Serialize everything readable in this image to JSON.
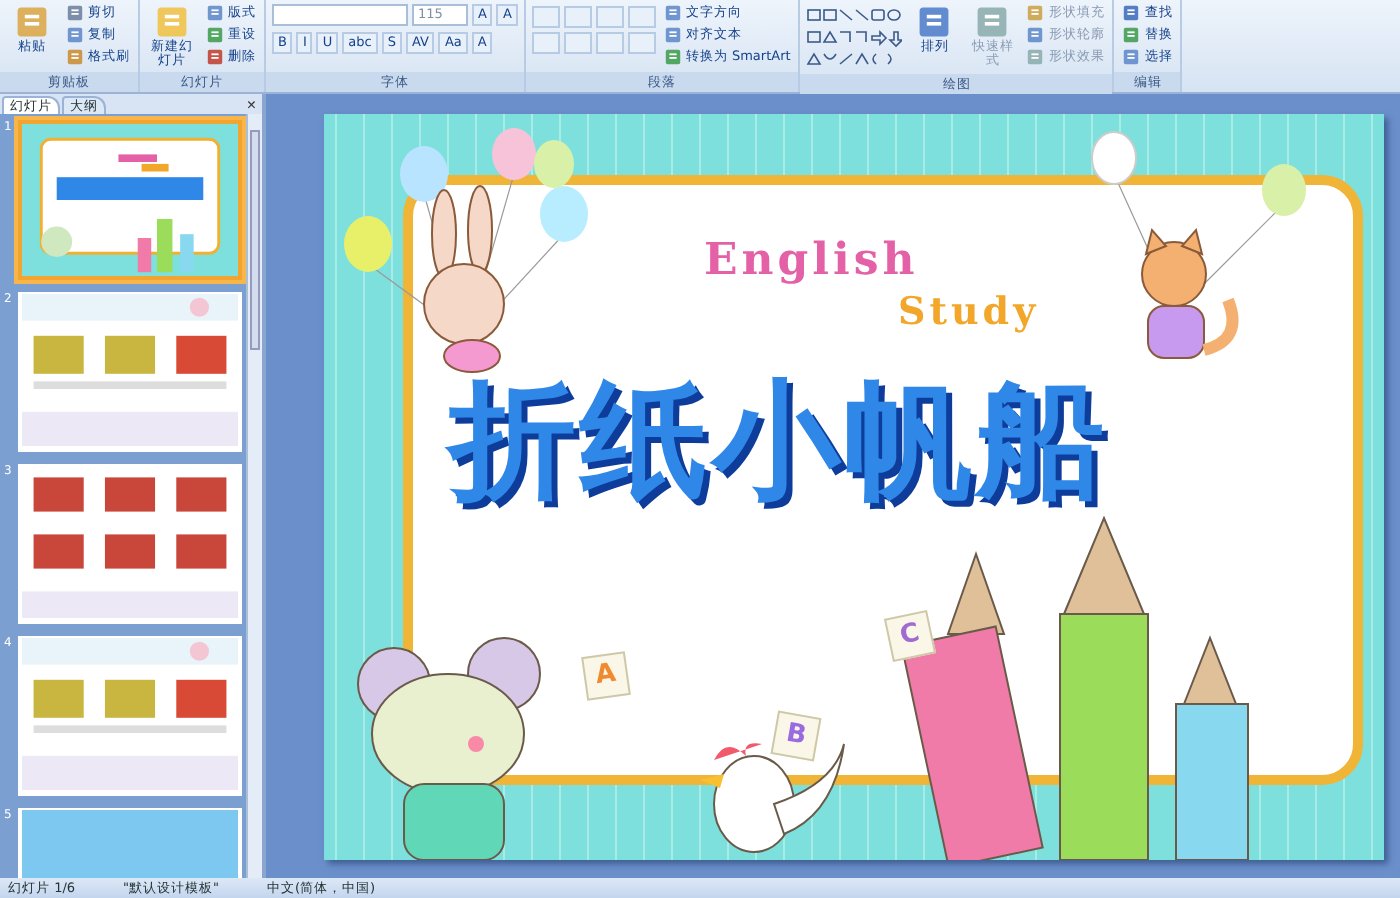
{
  "ribbon": {
    "groups": [
      {
        "label": "剪贴板",
        "items": [
          {
            "kind": "big",
            "label": "粘贴"
          },
          {
            "kind": "small",
            "label": "剪切"
          },
          {
            "kind": "small",
            "label": "复制"
          },
          {
            "kind": "small",
            "label": "格式刷"
          }
        ]
      },
      {
        "label": "幻灯片",
        "items": [
          {
            "kind": "big",
            "label": "新建幻灯片"
          },
          {
            "kind": "small",
            "label": "版式"
          },
          {
            "kind": "small",
            "label": "重设"
          },
          {
            "kind": "small",
            "label": "删除"
          }
        ]
      },
      {
        "label": "字体",
        "items": [
          {
            "kind": "font",
            "size": "115",
            "grow": "A",
            "shrink": "A",
            "styles": [
              "B",
              "I",
              "U",
              "abc",
              "S",
              "AV",
              "Aa",
              "A"
            ]
          }
        ]
      },
      {
        "label": "段落",
        "items": [
          {
            "kind": "para"
          },
          {
            "kind": "small",
            "label": "文字方向"
          },
          {
            "kind": "small",
            "label": "对齐文本"
          },
          {
            "kind": "small",
            "label": "转换为 SmartArt"
          }
        ]
      },
      {
        "label": "绘图",
        "items": [
          {
            "kind": "shapes"
          },
          {
            "kind": "big",
            "label": "排列"
          },
          {
            "kind": "big",
            "label": "快速样式",
            "disabled": true
          },
          {
            "kind": "small",
            "label": "形状填充",
            "disabled": true
          },
          {
            "kind": "small",
            "label": "形状轮廓",
            "disabled": true
          },
          {
            "kind": "small",
            "label": "形状效果",
            "disabled": true
          }
        ]
      },
      {
        "label": "编辑",
        "items": [
          {
            "kind": "small",
            "label": "查找"
          },
          {
            "kind": "small",
            "label": "替换"
          },
          {
            "kind": "small",
            "label": "选择"
          }
        ]
      }
    ]
  },
  "panel": {
    "tabs": [
      {
        "label": "幻灯片",
        "selected": true
      },
      {
        "label": "大纲",
        "selected": false
      }
    ],
    "close": "×",
    "slides": [
      {
        "number": "1",
        "selected": true,
        "kind": "title"
      },
      {
        "number": "2",
        "selected": false,
        "kind": "steps"
      },
      {
        "number": "3",
        "selected": false,
        "kind": "steps6"
      },
      {
        "number": "4",
        "selected": false,
        "kind": "steps"
      },
      {
        "number": "5",
        "selected": false,
        "kind": "sky"
      }
    ]
  },
  "slide": {
    "english": "English",
    "study": "Study",
    "title": "折纸小帆船",
    "cards": [
      "C",
      "A",
      "B"
    ]
  },
  "status_bar": {
    "slide": "幻灯片 1/6",
    "theme": "\"默认设计模板\"",
    "language": "中文(简体，中国)"
  }
}
